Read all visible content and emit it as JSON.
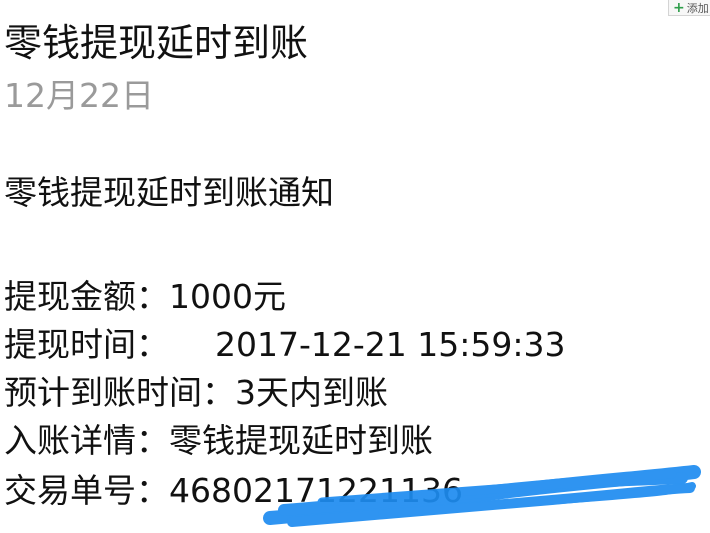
{
  "browser_tab": {
    "add_label": "添加"
  },
  "message": {
    "title": "零钱提现延时到账",
    "date": "12月22日",
    "heading": "零钱提现延时到账通知",
    "fields": [
      {
        "label": "提现金额：",
        "value": "1000元"
      },
      {
        "label": "提现时间：",
        "value": "2017-12-21 15:59:33"
      },
      {
        "label": "预计到账时间：",
        "value": "3天内到账"
      },
      {
        "label": "入账详情：",
        "value": "零钱提现延时到账"
      },
      {
        "label": "交易单号：",
        "value": "46802171221136"
      }
    ]
  },
  "colors": {
    "text": "#111111",
    "date_text": "#9a9a9a",
    "redaction_scribble": "#1e8cf0",
    "tab_plus": "#2e9e4a"
  },
  "icons": {
    "tab_add": "plus-icon"
  }
}
